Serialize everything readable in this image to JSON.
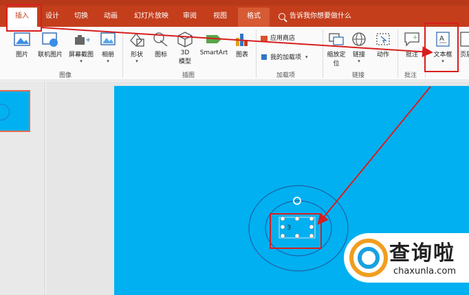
{
  "tabs": [
    {
      "label": "插入",
      "active": true
    },
    {
      "label": "设计"
    },
    {
      "label": "切换"
    },
    {
      "label": "动画"
    },
    {
      "label": "幻灯片放映"
    },
    {
      "label": "审阅"
    },
    {
      "label": "视图"
    },
    {
      "label": "格式"
    }
  ],
  "tell_me": "告诉我你想要做什么",
  "ribbon": {
    "images": {
      "picture": "图片",
      "online_picture": "联机图片",
      "screenshot": "屏幕截图",
      "album": "相册",
      "group": "图像"
    },
    "illustrations": {
      "shapes": "形状",
      "icons": "图标",
      "model_3d_line1": "3D",
      "model_3d_line2": "模型",
      "smartart": "SmartArt",
      "chart": "图表",
      "group": "插图"
    },
    "addins": {
      "store": "应用商店",
      "my_addins": "我的加载项",
      "group": "加载项"
    },
    "links": {
      "zoom_line1": "缩放定",
      "zoom_line2": "位",
      "link": "链接",
      "action": "动作",
      "group": "链接"
    },
    "comments": {
      "comment": "批注",
      "group": "批注"
    },
    "text": {
      "textbox": "文本框",
      "header": "页眉"
    }
  },
  "slide": {
    "textbox_content": "3"
  },
  "watermark": {
    "title": "查询啦",
    "url": "chaxunla.com"
  },
  "colors": {
    "accent": "#c43e1c",
    "slide_bg": "#00b0f0",
    "annotation": "#d81e1e"
  }
}
